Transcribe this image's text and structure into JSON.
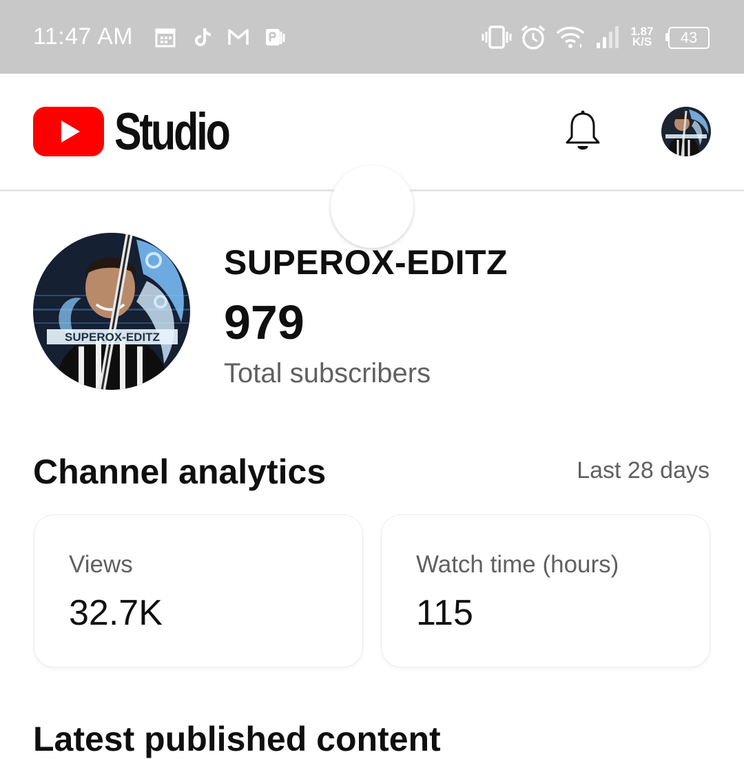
{
  "status_bar": {
    "time": "11:47 AM",
    "net_speed_value": "1.87",
    "net_speed_unit": "K/S",
    "battery": "43",
    "notification_icons": [
      "calendar-icon",
      "tiktok-icon",
      "gmail-icon",
      "wps-icon"
    ],
    "system_icons": [
      "vibrate-icon",
      "alarm-icon",
      "wifi-icon",
      "signal-icon"
    ]
  },
  "app_bar": {
    "title": "Studio",
    "brand_color": "#ff0000"
  },
  "channel": {
    "name": "SUPEROX-EDITZ",
    "subscriber_count": "979",
    "subscriber_label": "Total subscribers"
  },
  "analytics": {
    "title": "Channel analytics",
    "range": "Last 28 days",
    "cards": [
      {
        "label": "Views",
        "value": "32.7K"
      },
      {
        "label": "Watch time (hours)",
        "value": "115"
      }
    ]
  },
  "latest": {
    "title": "Latest published content"
  }
}
